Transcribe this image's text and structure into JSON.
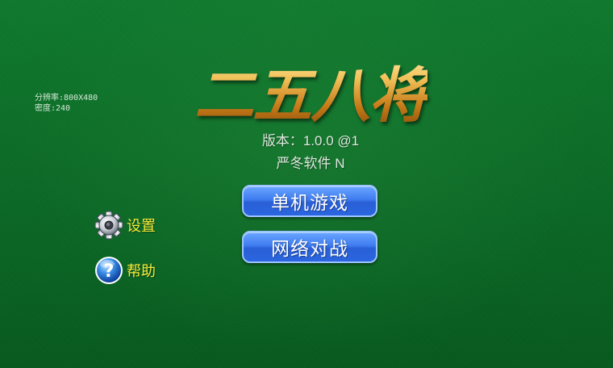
{
  "debug": {
    "resolution": "分辨率:800X480",
    "density": "密度:240"
  },
  "title": "二五八将",
  "version": "版本：1.0.0 @1",
  "company": "严冬软件 N",
  "menu": {
    "single_player": "单机游戏",
    "network_battle": "网络对战"
  },
  "side": {
    "settings": {
      "label": "设置",
      "icon": "gear-icon"
    },
    "help": {
      "label": "帮助",
      "icon": "help-icon"
    }
  }
}
